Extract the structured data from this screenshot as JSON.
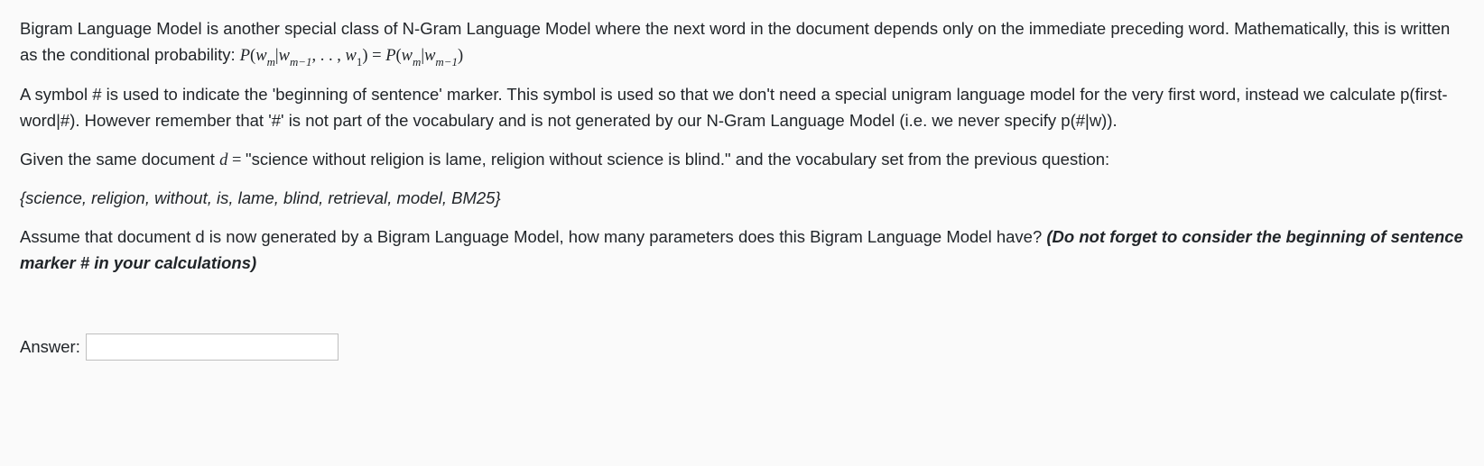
{
  "para1_a": "Bigram Language Model is another special class of N-Gram Language Model where the next word in the document depends only on the immediate preceding word. Mathematically, this is written as the conditional probability: ",
  "para2": "A symbol # is used to indicate the 'beginning of sentence' marker. This symbol is used so that we don't need a special unigram language model for the very first word, instead we calculate p(first-word|#). However remember that '#' is not part of the vocabulary and is not generated by our N-Gram Language Model (i.e. we never specify p(#|w)).",
  "para3_a": "Given the same document ",
  "para3_b": " \"science without religion is lame, religion without science is blind.\" and the vocabulary set from the previous question:",
  "vocab": "{science, religion, without, is, lame, blind, retrieval, model, BM25}",
  "para5_a": "Assume that document d is now generated by a Bigram Language Model, how many parameters does this Bigram Language Model have? ",
  "para5_b": "(Do not forget to consider the beginning of sentence marker # in your calculations)",
  "answer_label": "Answer:",
  "answer_value": "",
  "math": {
    "P": "P",
    "w": "w",
    "m": "m",
    "m1": "m−1",
    "one": "1",
    "dots": ", . . , ",
    "bar": "|",
    "lp": "(",
    "rp": ")",
    "eq": " = ",
    "d": "d",
    "eq2": " = "
  }
}
